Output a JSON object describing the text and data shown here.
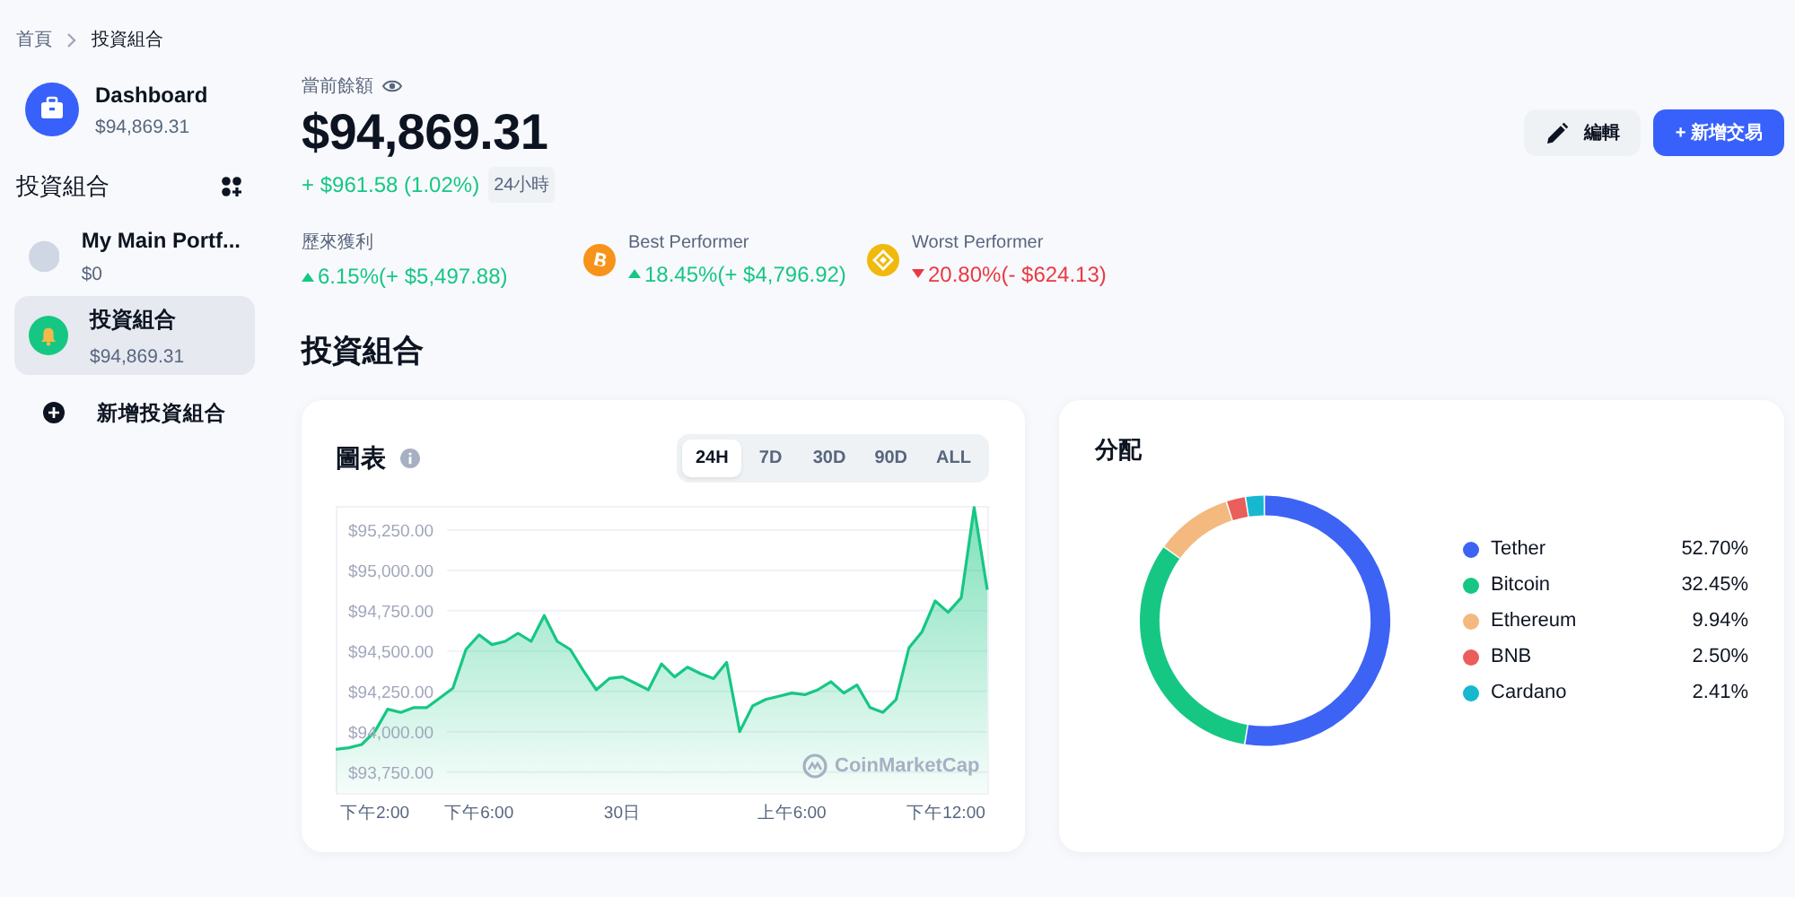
{
  "breadcrumb": [
    {
      "label": "首頁"
    },
    {
      "label": "投資組合"
    }
  ],
  "sidebar": {
    "dashboard": {
      "title": "Dashboard",
      "value": "$94,869.31"
    },
    "section_title": "投資組合",
    "portfolios": [
      {
        "name": "My Main Portf...",
        "value": "$0",
        "selected": false,
        "kind": "blank"
      },
      {
        "name": "投資組合",
        "value": "$94,869.31",
        "selected": true,
        "kind": "bell"
      }
    ],
    "add_label": "新增投資組合"
  },
  "balance": {
    "label": "當前餘額",
    "amount": "$94,869.31",
    "change": "+ $961.58 (1.02%)",
    "period": "24小時"
  },
  "actions": [
    {
      "label": "編輯",
      "kind": "edit"
    },
    {
      "label": "+ 新增交易",
      "kind": "primary"
    }
  ],
  "stats": [
    {
      "label": "歷來獲利",
      "value": "6.15%(+ $5,497.88)",
      "positive": true,
      "kind": "total"
    },
    {
      "label": "Best Performer",
      "value": "18.45%(+ $4,796.92)",
      "positive": true,
      "kind": "bitcoin"
    },
    {
      "label": "Worst Performer",
      "value": "20.80%(- $624.13)",
      "positive": false,
      "kind": "bnb"
    }
  ],
  "section_title": "投資組合",
  "chart_card": {
    "title": "圖表",
    "ranges": [
      {
        "label": "24H",
        "selected": true
      },
      {
        "label": "7D",
        "selected": false
      },
      {
        "label": "30D",
        "selected": false
      },
      {
        "label": "90D",
        "selected": false
      },
      {
        "label": "ALL",
        "selected": false
      }
    ],
    "watermark": "CoinMarketCap",
    "chart_data": {
      "type": "area",
      "grid": true,
      "ylim": [
        93620,
        95400
      ],
      "categories": [
        null,
        null,
        null,
        "下午2:00",
        null,
        null,
        null,
        null,
        null,
        null,
        null,
        "下午6:00",
        null,
        null,
        null,
        null,
        null,
        null,
        null,
        null,
        null,
        null,
        "30日",
        null,
        null,
        null,
        null,
        null,
        null,
        null,
        null,
        null,
        null,
        null,
        null,
        "上午6:00",
        null,
        null,
        null,
        null,
        null,
        null,
        null,
        null,
        null,
        null,
        null,
        "下午12:00",
        null,
        null,
        null
      ],
      "series": [
        {
          "color": "#16c784",
          "values": [
            93890,
            93900,
            93920,
            94000,
            94140,
            94120,
            94150,
            94150,
            94210,
            94270,
            94510,
            94600,
            94540,
            94560,
            94610,
            94560,
            94720,
            94560,
            94510,
            94380,
            94260,
            94330,
            94340,
            94300,
            94260,
            94420,
            94340,
            94400,
            94360,
            94330,
            94430,
            94000,
            94160,
            94200,
            94220,
            94240,
            94230,
            94260,
            94310,
            94240,
            94290,
            94150,
            94120,
            94200,
            94520,
            94620,
            94810,
            94740,
            94830,
            95390,
            94880
          ]
        }
      ],
      "yticks": [
        {
          "value": 93750,
          "label": "$93,750.00"
        },
        {
          "value": 94000,
          "label": "$94,000.00"
        },
        {
          "value": 94250,
          "label": "$94,250.00"
        },
        {
          "value": 94500,
          "label": "$94,500.00"
        },
        {
          "value": 94750,
          "label": "$94,750.00"
        },
        {
          "value": 95000,
          "label": "$95,000.00"
        },
        {
          "value": 95250,
          "label": "$95,250.00"
        }
      ]
    }
  },
  "allocation": {
    "title": "分配",
    "chart_data": {
      "type": "donut",
      "categories": [
        "Tether",
        "Bitcoin",
        "Ethereum",
        "BNB",
        "Cardano"
      ],
      "values": [
        52.7,
        32.45,
        9.94,
        2.5,
        2.41
      ]
    },
    "legend": [
      {
        "share": "52.70%",
        "color": "#3d63f5"
      },
      {
        "share": "32.45%",
        "color": "#16c784"
      },
      {
        "share": "9.94%",
        "color": "#f3b97f"
      },
      {
        "share": "2.50%",
        "color": "#ea5e5b"
      },
      {
        "share": "2.41%",
        "color": "#16b8d0"
      }
    ]
  }
}
